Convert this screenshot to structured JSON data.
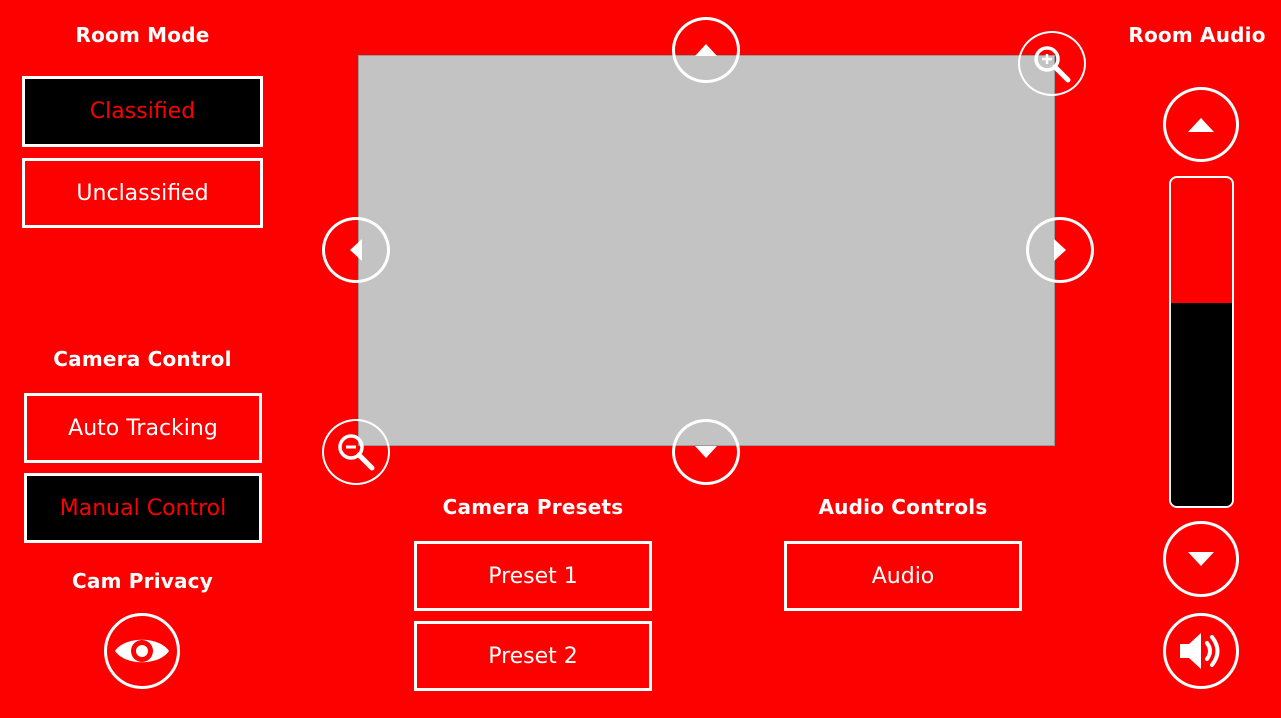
{
  "room_mode": {
    "title": "Room Mode",
    "classified_label": "Classified",
    "unclassified_label": "Unclassified",
    "selected": "Classified"
  },
  "camera_control": {
    "title": "Camera Control",
    "auto_tracking_label": "Auto Tracking",
    "manual_control_label": "Manual Control",
    "selected": "Manual Control"
  },
  "cam_privacy": {
    "title": "Cam Privacy",
    "icon": "eye-icon"
  },
  "camera_view": {
    "pan_up_icon": "chevron-up-icon",
    "pan_down_icon": "chevron-down-icon",
    "pan_left_icon": "chevron-left-icon",
    "pan_right_icon": "chevron-right-icon",
    "zoom_in_icon": "zoom-in-icon",
    "zoom_out_icon": "zoom-out-icon"
  },
  "camera_presets": {
    "title": "Camera Presets",
    "preset_1_label": "Preset 1",
    "preset_2_label": "Preset 2"
  },
  "audio_controls": {
    "title": "Audio Controls",
    "audio_label": "Audio"
  },
  "room_audio": {
    "title": "Room Audio",
    "volume_level": 0.62,
    "volume_up_icon": "triangle-up-icon",
    "volume_down_icon": "triangle-down-icon",
    "speaker_icon": "speaker-icon"
  },
  "colors": {
    "background": "#fd0000",
    "foreground": "#ffffff",
    "active_background": "#000000",
    "active_text": "#fd0000",
    "preview": "#c3c3c3"
  }
}
